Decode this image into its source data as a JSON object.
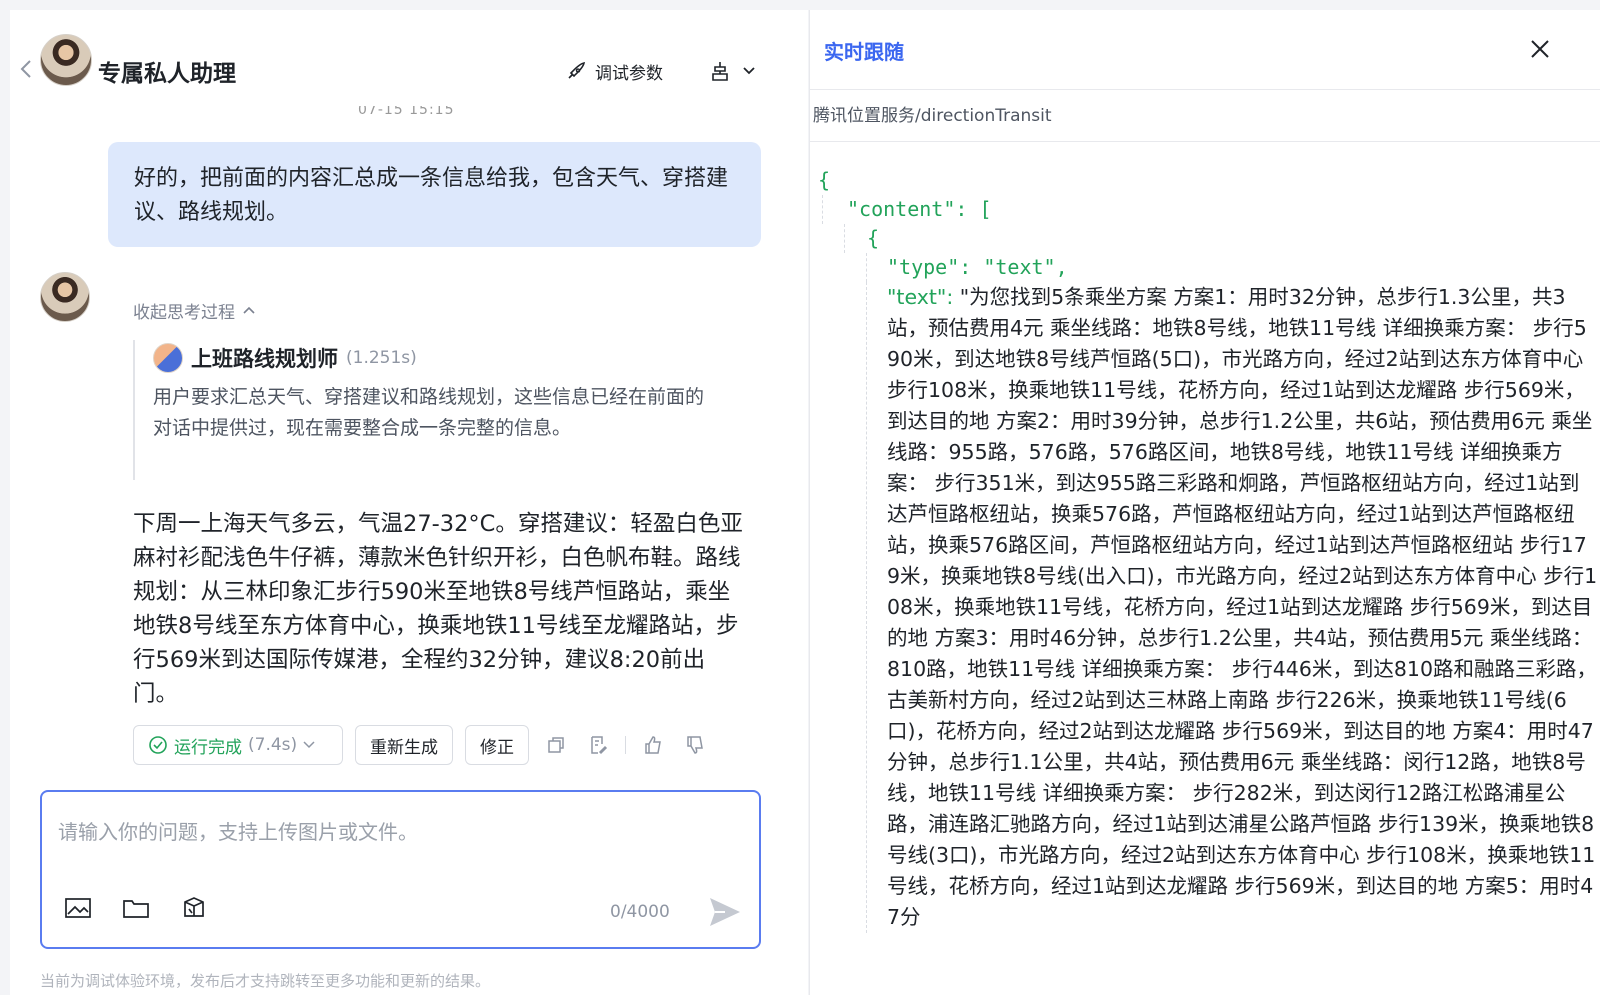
{
  "header": {
    "title": "专属私人助理",
    "debug_label": "调试参数",
    "timestamp_fragment": "07-15 15:15"
  },
  "messages": {
    "user_text": "好的，把前面的内容汇总成一条信息给我，包含天气、穿搭建议、路线规划。",
    "think_toggle_label": "收起思考过程",
    "agent_name": "上班路线规划师",
    "agent_time": "(1.251s)",
    "think_text": "用户要求汇总天气、穿搭建议和路线规划，这些信息已经在前面的对话中提供过，现在需要整合成一条完整的信息。",
    "answer_text": "下周一上海天气多云，气温27-32°C。穿搭建议：轻盈白色亚麻衬衫配浅色牛仔裤，薄款米色针织开衫，白色帆布鞋。路线规划：从三林印象汇步行590米至地铁8号线芦恒路站，乘坐地铁8号线至东方体育中心，换乘地铁11号线至龙耀路站，步行569米到达国际传媒港，全程约32分钟，建议8:20前出门。"
  },
  "actions": {
    "status_label": "运行完成",
    "status_time": "(7.4s)",
    "regenerate_label": "重新生成",
    "revise_label": "修正"
  },
  "composer": {
    "placeholder": "请输入你的问题，支持上传图片或文件。",
    "counter": "0/4000"
  },
  "footer_note": "当前为调试体验环境，发布后才支持跳转至更多功能和更新的结果。",
  "right_panel": {
    "title": "实时跟随",
    "path": "腾讯位置服务/directionTransit",
    "json_open": "{",
    "content_key": "\"content\": [",
    "item_open": "{",
    "type_line": "\"type\": \"text\",",
    "text_key": "\"text\": ",
    "text_value": "\"为您找到5条乘坐方案 方案1：用时32分钟，总步行1.3公里，共3站，预估费用4元 乘坐线路：地铁8号线，地铁11号线 详细换乘方案： 步行590米，到达地铁8号线芦恒路(5口)，市光路方向，经过2站到达东方体育中心 步行108米，换乘地铁11号线，花桥方向，经过1站到达龙耀路 步行569米，到达目的地 方案2：用时39分钟，总步行1.2公里，共6站，预估费用6元 乘坐线路：955路，576路，576路区间，地铁8号线，地铁11号线 详细换乘方案： 步行351米，到达955路三彩路和炯路，芦恒路枢纽站方向，经过1站到达芦恒路枢纽站，换乘576路，芦恒路枢纽站方向，经过1站到达芦恒路枢纽站，换乘576路区间，芦恒路枢纽站方向，经过1站到达芦恒路枢纽站 步行179米，换乘地铁8号线(出入口)，市光路方向，经过2站到达东方体育中心 步行108米，换乘地铁11号线，花桥方向，经过1站到达龙耀路 步行569米，到达目的地 方案3：用时46分钟，总步行1.2公里，共4站，预估费用5元 乘坐线路：810路，地铁11号线 详细换乘方案： 步行446米，到达810路和融路三彩路，古美新村方向，经过2站到达三林路上南路 步行226米，换乘地铁11号线(6口)，花桥方向，经过2站到达龙耀路 步行569米，到达目的地 方案4：用时47分钟，总步行1.1公里，共4站，预估费用6元 乘坐线路：闵行12路，地铁8号线，地铁11号线 详细换乘方案： 步行282米，到达闵行12路江松路浦星公路，浦连路汇驰路方向，经过1站到达浦星公路芦恒路 步行139米，换乘地铁8号线(3口)，市光路方向，经过2站到达东方体育中心 步行108米，换乘地铁11号线，花桥方向，经过1站到达龙耀路 步行569米，到达目的地 方案5：用时47分"
  },
  "colors": {
    "accent": "#3b67f0",
    "user_bubble": "#dde8fc",
    "success": "#22a35a",
    "json_key": "#22a35a"
  }
}
